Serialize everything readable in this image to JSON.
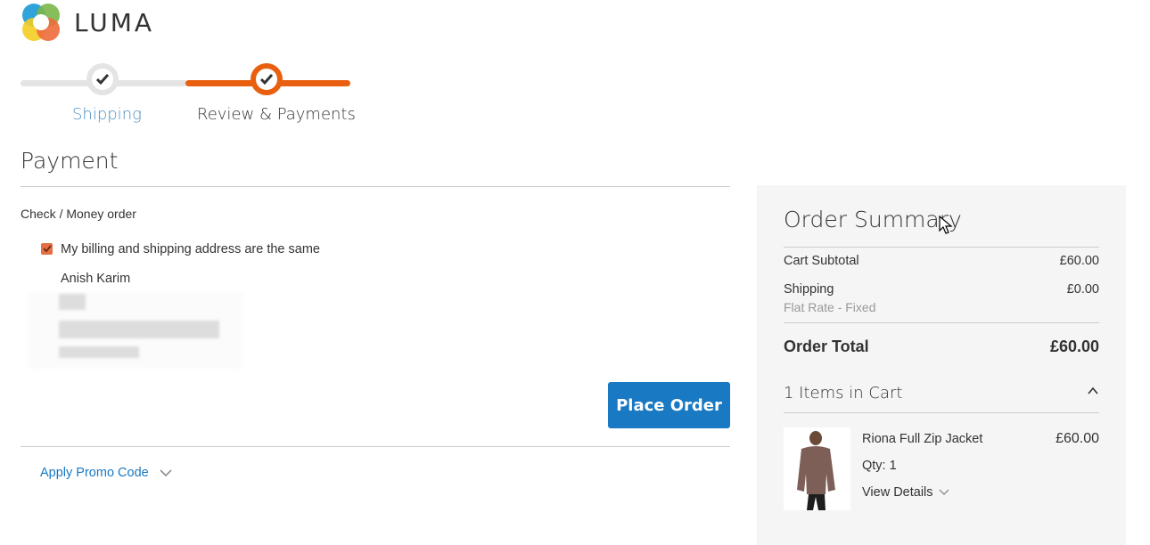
{
  "brand": {
    "name": "LUMA"
  },
  "progress": {
    "steps": [
      {
        "label": "Shipping",
        "state": "complete"
      },
      {
        "label": "Review & Payments",
        "state": "active"
      }
    ]
  },
  "payment": {
    "title": "Payment",
    "method_label": "Check / Money order",
    "same_address_label": "My billing and shipping address are the same",
    "same_address_checked": true,
    "address_name": "Anish Karim",
    "place_order_label": "Place Order",
    "promo_label": "Apply Promo Code"
  },
  "summary": {
    "title": "Order Summary",
    "subtotal_label": "Cart Subtotal",
    "subtotal_value": "£60.00",
    "shipping_label": "Shipping",
    "shipping_value": "£0.00",
    "shipping_method": "Flat Rate - Fixed",
    "total_label": "Order Total",
    "total_value": "£60.00",
    "items_title": "1 Items in Cart",
    "items": [
      {
        "name": "Riona Full Zip Jacket",
        "qty": "Qty: 1",
        "price": "£60.00",
        "details_label": "View Details"
      }
    ]
  },
  "colors": {
    "accent_orange": "#e95f10",
    "primary_blue": "#1979c3",
    "link_blue": "#1979c3",
    "summary_bg": "#f5f5f5"
  }
}
